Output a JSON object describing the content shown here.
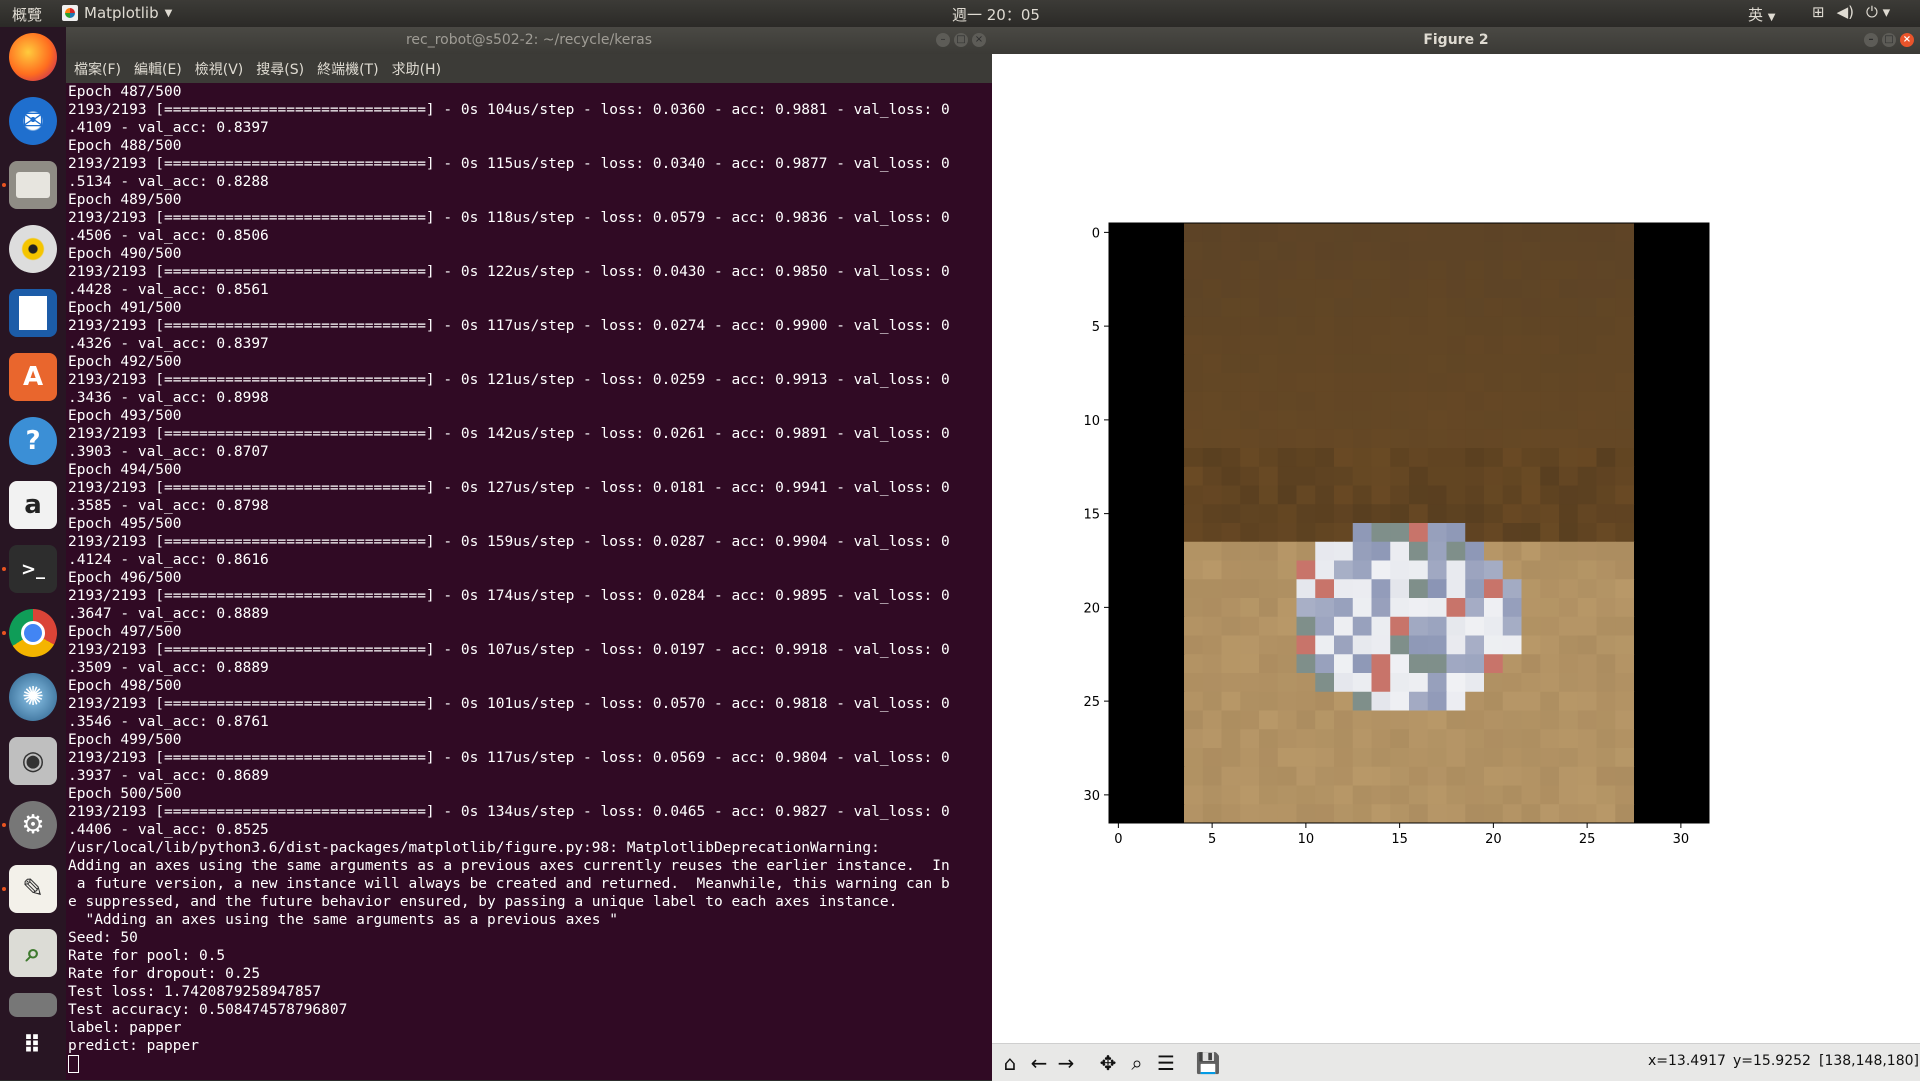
{
  "top_panel": {
    "activities": "概覽",
    "app_name": "Matplotlib",
    "clock": "週一 20：05",
    "ime": "英"
  },
  "launcher": {
    "icons": [
      "firefox-icon",
      "thunderbird-icon",
      "files-icon",
      "rhythmbox-icon",
      "writer-icon",
      "software-center-icon",
      "help-icon",
      "amazon-icon",
      "terminal-icon",
      "chrome-icon",
      "spyder-icon",
      "screenshot-icon",
      "settings-icon",
      "text-editor-icon",
      "image-viewer-icon",
      "disk-icon",
      "app-grid-icon"
    ]
  },
  "terminal": {
    "title": "rec_robot@s502-2: ~/recycle/keras",
    "menu": [
      "檔案(F)",
      "編輯(E)",
      "檢視(V)",
      "搜尋(S)",
      "終端機(T)",
      "求助(H)"
    ],
    "lines": [
      "Epoch 487/500",
      "2193/2193 [==============================] - 0s 104us/step - loss: 0.0360 - acc: 0.9881 - val_loss: 0",
      ".4109 - val_acc: 0.8397",
      "Epoch 488/500",
      "2193/2193 [==============================] - 0s 115us/step - loss: 0.0340 - acc: 0.9877 - val_loss: 0",
      ".5134 - val_acc: 0.8288",
      "Epoch 489/500",
      "2193/2193 [==============================] - 0s 118us/step - loss: 0.0579 - acc: 0.9836 - val_loss: 0",
      ".4506 - val_acc: 0.8506",
      "Epoch 490/500",
      "2193/2193 [==============================] - 0s 122us/step - loss: 0.0430 - acc: 0.9850 - val_loss: 0",
      ".4428 - val_acc: 0.8561",
      "Epoch 491/500",
      "2193/2193 [==============================] - 0s 117us/step - loss: 0.0274 - acc: 0.9900 - val_loss: 0",
      ".4326 - val_acc: 0.8397",
      "Epoch 492/500",
      "2193/2193 [==============================] - 0s 121us/step - loss: 0.0259 - acc: 0.9913 - val_loss: 0",
      ".3436 - val_acc: 0.8998",
      "Epoch 493/500",
      "2193/2193 [==============================] - 0s 142us/step - loss: 0.0261 - acc: 0.9891 - val_loss: 0",
      ".3903 - val_acc: 0.8707",
      "Epoch 494/500",
      "2193/2193 [==============================] - 0s 127us/step - loss: 0.0181 - acc: 0.9941 - val_loss: 0",
      ".3585 - val_acc: 0.8798",
      "Epoch 495/500",
      "2193/2193 [==============================] - 0s 159us/step - loss: 0.0287 - acc: 0.9904 - val_loss: 0",
      ".4124 - val_acc: 0.8616",
      "Epoch 496/500",
      "2193/2193 [==============================] - 0s 174us/step - loss: 0.0284 - acc: 0.9895 - val_loss: 0",
      ".3647 - val_acc: 0.8889",
      "Epoch 497/500",
      "2193/2193 [==============================] - 0s 107us/step - loss: 0.0197 - acc: 0.9918 - val_loss: 0",
      ".3509 - val_acc: 0.8889",
      "Epoch 498/500",
      "2193/2193 [==============================] - 0s 101us/step - loss: 0.0570 - acc: 0.9818 - val_loss: 0",
      ".3546 - val_acc: 0.8761",
      "Epoch 499/500",
      "2193/2193 [==============================] - 0s 117us/step - loss: 0.0569 - acc: 0.9804 - val_loss: 0",
      ".3937 - val_acc: 0.8689",
      "Epoch 500/500",
      "2193/2193 [==============================] - 0s 134us/step - loss: 0.0465 - acc: 0.9827 - val_loss: 0",
      ".4406 - val_acc: 0.8525",
      "/usr/local/lib/python3.6/dist-packages/matplotlib/figure.py:98: MatplotlibDeprecationWarning:",
      "Adding an axes using the same arguments as a previous axes currently reuses the earlier instance.  In",
      " a future version, a new instance will always be created and returned.  Meanwhile, this warning can b",
      "e suppressed, and the future behavior ensured, by passing a unique label to each axes instance.",
      "  \"Adding an axes using the same arguments as a previous axes \"",
      "Seed: 50",
      "Rate for pool: 0.5",
      "Rate for dropout: 0.25",
      "Test loss: 1.7420879258947857",
      "Test accuracy: 0.508474578796807",
      "label: papper",
      "predict: papper"
    ]
  },
  "figure": {
    "title": "Figure 2",
    "status": {
      "x": "x=13.4917",
      "y": "y=15.9252",
      "rgb": "[138,148,180]"
    }
  },
  "chart_data": {
    "type": "heatmap",
    "title": "",
    "xlabel": "",
    "ylabel": "",
    "image_size": [
      32,
      32
    ],
    "xlim": [
      -0.5,
      31.5
    ],
    "ylim": [
      31.5,
      -0.5
    ],
    "x_ticks": [
      "0",
      "5",
      "10",
      "15",
      "20",
      "25",
      "30"
    ],
    "y_ticks": [
      "0",
      "5",
      "10",
      "15",
      "20",
      "25",
      "30"
    ],
    "black_columns": [
      0,
      1,
      2,
      3,
      28,
      29,
      30,
      31
    ],
    "colors": {
      "border": "#000000",
      "background_top": "#5c4326",
      "background_mid": "#6a4a24",
      "table": "#b89868",
      "object_light": "#e4e6ec",
      "object_blue": "#8a94b4",
      "object_red": "#c8746a"
    },
    "grid": false,
    "legend": "none"
  }
}
